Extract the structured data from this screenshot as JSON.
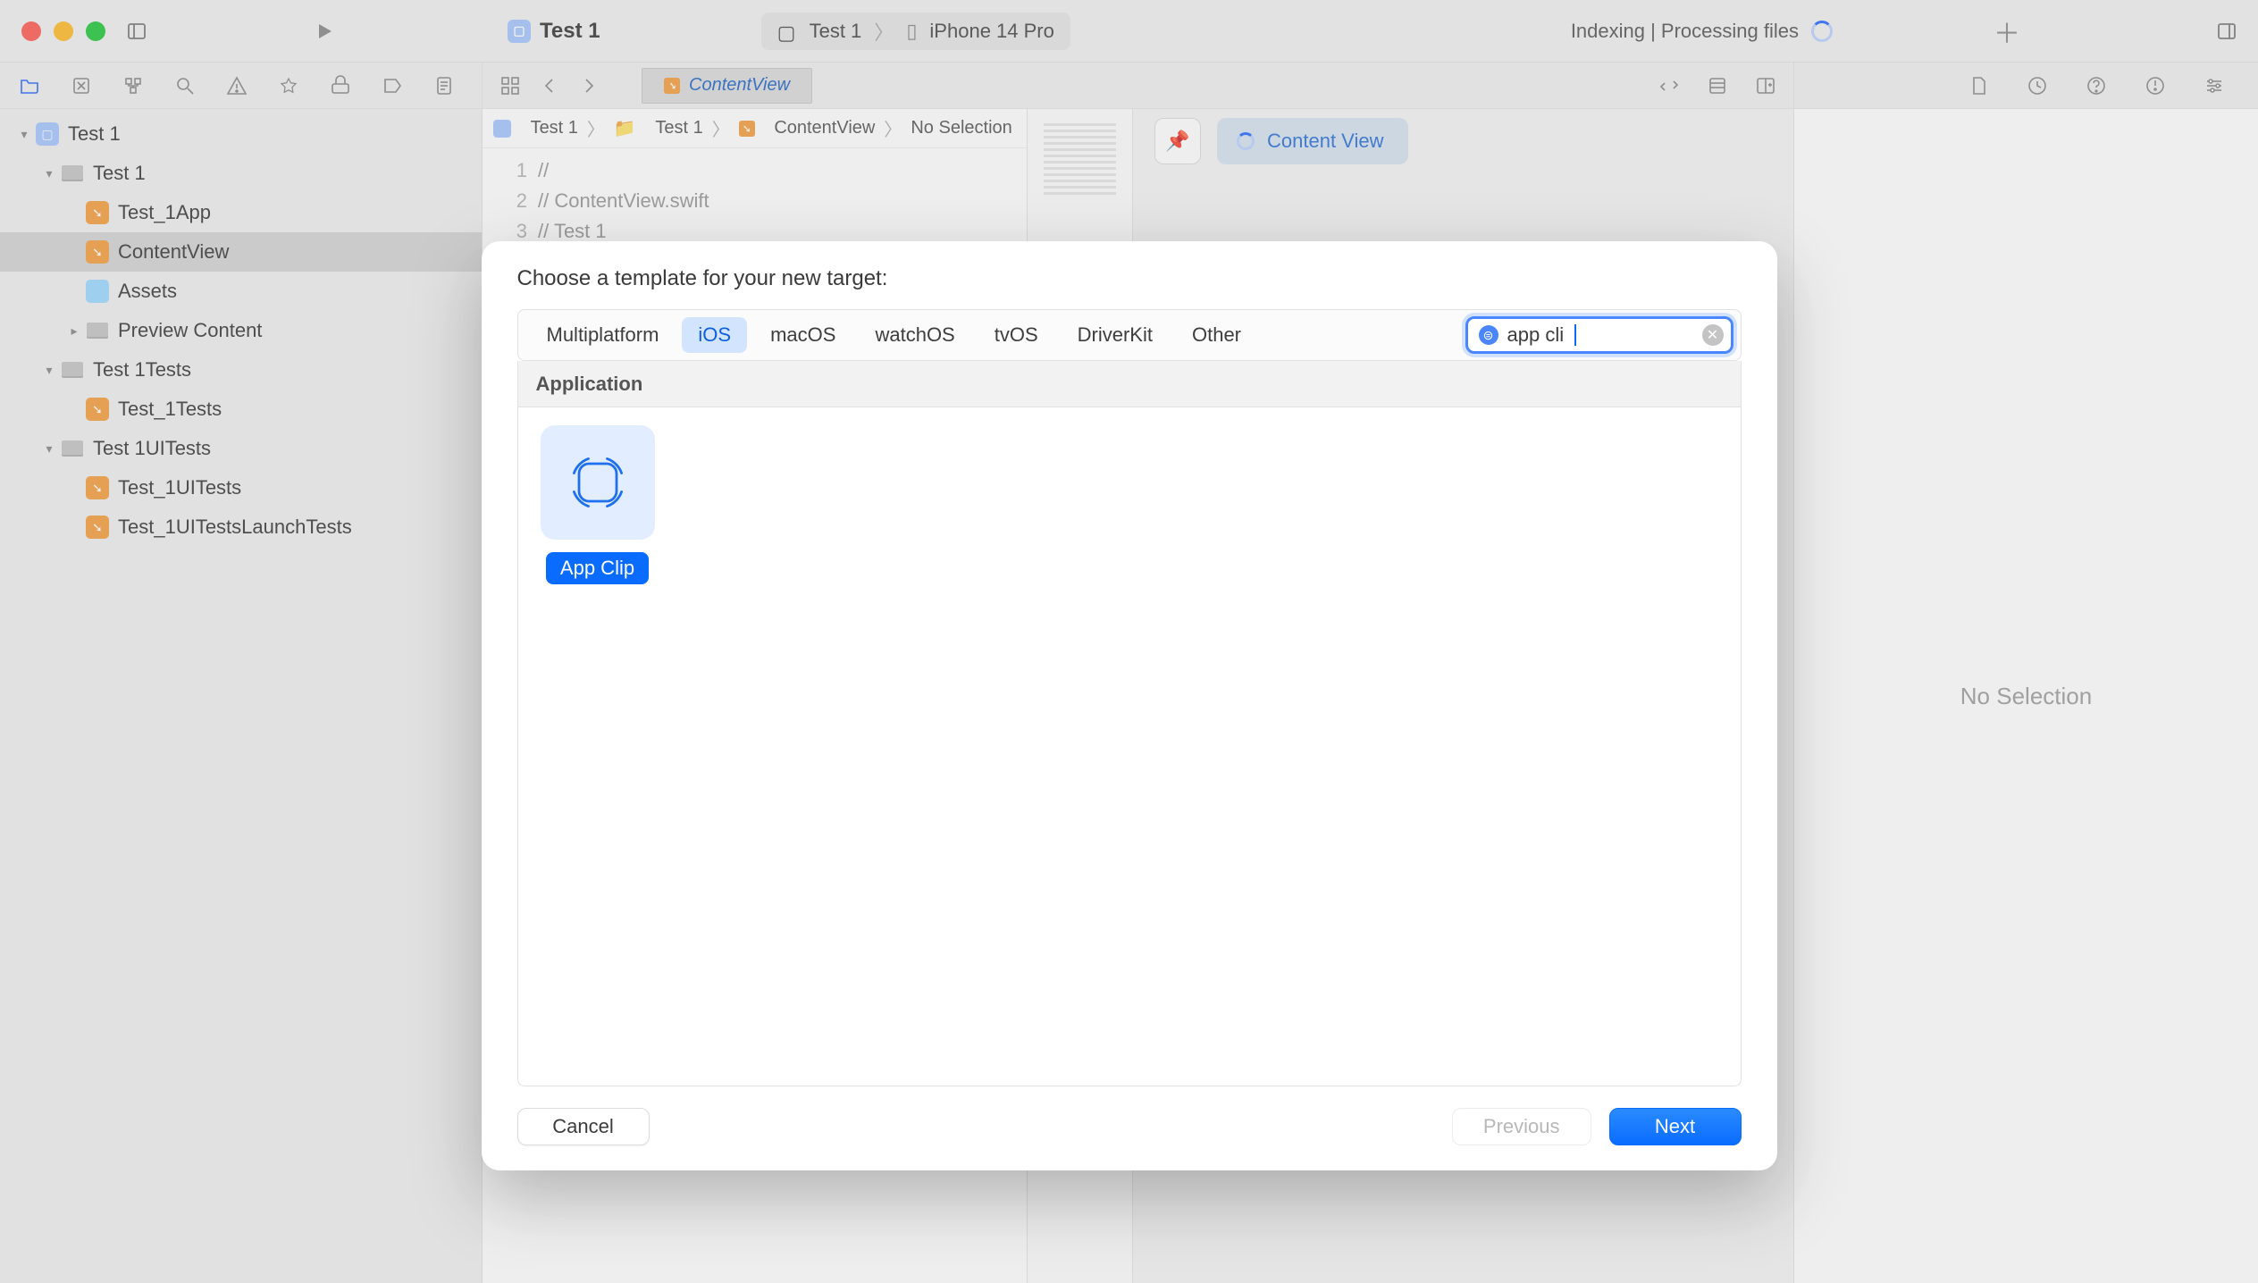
{
  "window": {
    "project_name": "Test 1",
    "scheme": "Test 1",
    "destination": "iPhone 14 Pro",
    "status": "Indexing | Processing files",
    "editor_tab": "ContentView"
  },
  "jumpbar": {
    "scheme": "Test 1",
    "group": "Test 1",
    "file": "ContentView",
    "selection": "No Selection"
  },
  "code": {
    "lines": [
      "//",
      "//  ContentView.swift",
      "//  Test 1"
    ]
  },
  "canvas": {
    "preview_label": "Content View"
  },
  "inspector": {
    "empty_text": "No Selection"
  },
  "navigator": {
    "items": [
      {
        "label": "Test 1",
        "depth": 0,
        "icon": "project",
        "disclosure": "▾"
      },
      {
        "label": "Test 1",
        "depth": 1,
        "icon": "folder",
        "disclosure": "▾"
      },
      {
        "label": "Test_1App",
        "depth": 2,
        "icon": "swift",
        "disclosure": ""
      },
      {
        "label": "ContentView",
        "depth": 2,
        "icon": "swift",
        "disclosure": "",
        "selected": true
      },
      {
        "label": "Assets",
        "depth": 2,
        "icon": "assets",
        "disclosure": ""
      },
      {
        "label": "Preview Content",
        "depth": 2,
        "icon": "folder",
        "disclosure": "▸"
      },
      {
        "label": "Test 1Tests",
        "depth": 1,
        "icon": "folder",
        "disclosure": "▾"
      },
      {
        "label": "Test_1Tests",
        "depth": 2,
        "icon": "swift",
        "disclosure": ""
      },
      {
        "label": "Test 1UITests",
        "depth": 1,
        "icon": "folder",
        "disclosure": "▾"
      },
      {
        "label": "Test_1UITests",
        "depth": 2,
        "icon": "swift",
        "disclosure": ""
      },
      {
        "label": "Test_1UITestsLaunchTests",
        "depth": 2,
        "icon": "swift",
        "disclosure": ""
      }
    ]
  },
  "sheet": {
    "title": "Choose a template for your new target:",
    "platforms": [
      "Multiplatform",
      "iOS",
      "macOS",
      "watchOS",
      "tvOS",
      "DriverKit",
      "Other"
    ],
    "active_platform": "iOS",
    "search_value": "app cli",
    "section": "Application",
    "templates": [
      {
        "label": "App Clip"
      }
    ],
    "buttons": {
      "cancel": "Cancel",
      "previous": "Previous",
      "next": "Next"
    }
  },
  "colors": {
    "traffic": {
      "close": "#ff5f57",
      "minimize": "#febc2e",
      "zoom": "#28c840"
    }
  }
}
